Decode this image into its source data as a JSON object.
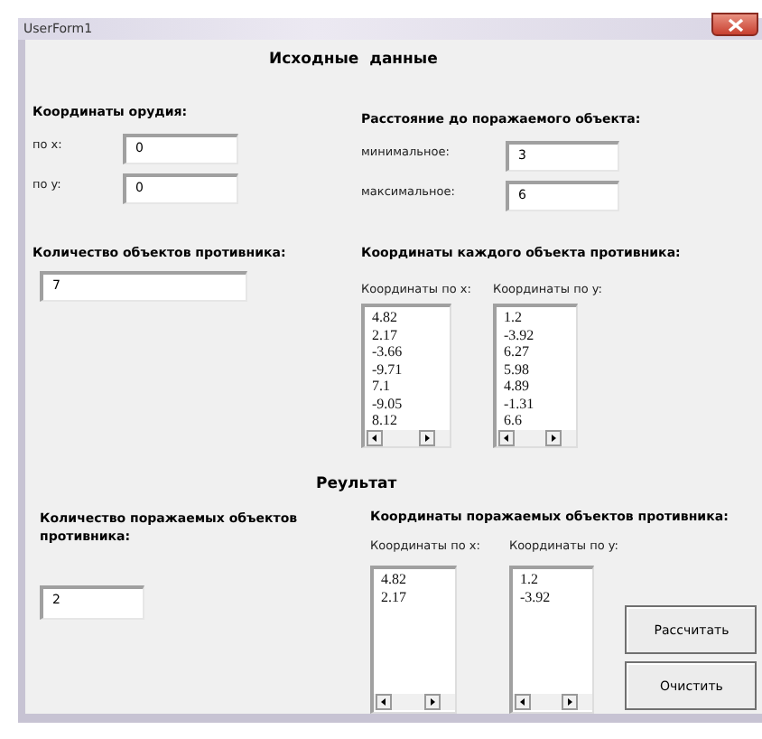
{
  "window": {
    "title": "UserForm1"
  },
  "input_heading": "Исходные  данные",
  "gun": {
    "label": "Координаты орудия:",
    "fields": [
      {
        "label": "по x:",
        "value": "0"
      },
      {
        "label": "по y:",
        "value": "0"
      }
    ]
  },
  "distance": {
    "label": "Расстояние до поражаемого объекта:",
    "fields": [
      {
        "label": "минимальное:",
        "value": "3"
      },
      {
        "label": "максимальное:",
        "value": "6"
      }
    ]
  },
  "enemy_count": {
    "label": "Количество объектов противника:",
    "value": "7"
  },
  "enemy_coords": {
    "label": "Координаты каждого объекта противника:",
    "lists": [
      {
        "label": "Координаты по x:",
        "items": [
          "4.82",
          "2.17",
          "-3.66",
          "-9.71",
          "7.1",
          "-9.05",
          "8.12"
        ]
      },
      {
        "label": "Координаты по y:",
        "items": [
          "1.2",
          "-3.92",
          "6.27",
          "5.98",
          "4.89",
          "-1.31",
          "6.6"
        ]
      }
    ]
  },
  "result_heading": "Реультат",
  "hit_count": {
    "label": "Количество поражаемых объектов противника:",
    "value": "2"
  },
  "hit_coords": {
    "label": "Координаты поражаемых объектов противника:",
    "lists": [
      {
        "label": "Координаты по x:",
        "items": [
          "4.82",
          "2.17"
        ]
      },
      {
        "label": "Координаты по y:",
        "items": [
          "1.2",
          "-3.92"
        ]
      }
    ]
  },
  "buttons": [
    "Рассчитать",
    "Очистить"
  ]
}
